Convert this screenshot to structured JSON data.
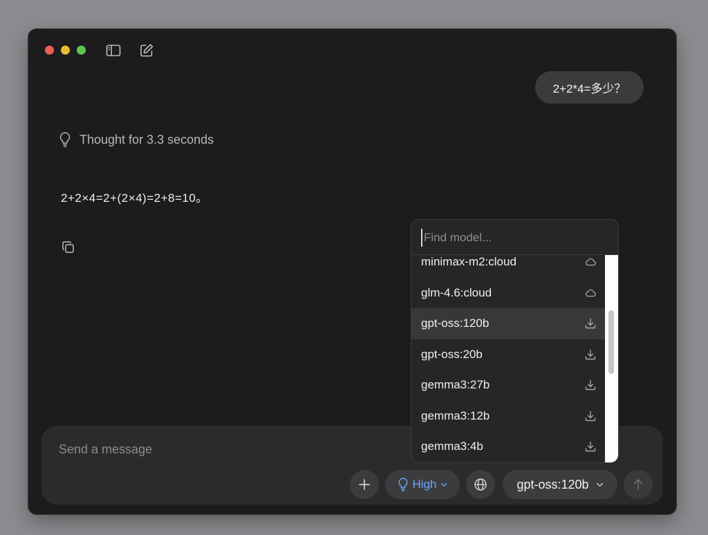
{
  "conversation": {
    "user_message": "2+2*4=多少？",
    "thought_label": "Thought for 3.3 seconds",
    "answer": "2+2×4=2+(2×4)=2+8=10。"
  },
  "composer": {
    "placeholder": "Send a message",
    "think_level": "High",
    "model": "gpt-oss:120b"
  },
  "model_menu": {
    "search_placeholder": "Find model...",
    "items": [
      {
        "name": "minimax-m2:cloud",
        "icon": "cloud-icon"
      },
      {
        "name": "glm-4.6:cloud",
        "icon": "cloud-icon"
      },
      {
        "name": "gpt-oss:120b",
        "icon": "download-icon",
        "selected": true
      },
      {
        "name": "gpt-oss:20b",
        "icon": "download-icon"
      },
      {
        "name": "gemma3:27b",
        "icon": "download-icon"
      },
      {
        "name": "gemma3:12b",
        "icon": "download-icon"
      },
      {
        "name": "gemma3:4b",
        "icon": "download-icon"
      }
    ]
  },
  "colors": {
    "accent": "#6fa6ff",
    "window_bg": "#1c1c1d",
    "composer_bg": "#2b2b2d"
  }
}
